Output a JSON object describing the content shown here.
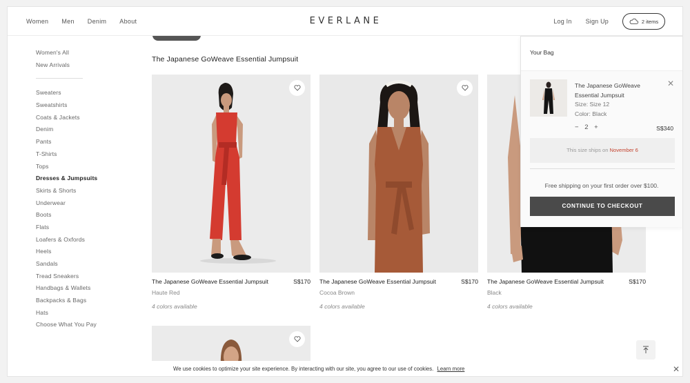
{
  "header": {
    "nav": [
      "Women",
      "Men",
      "Denim",
      "About"
    ],
    "logo": "EVERLANE",
    "login": "Log In",
    "signup": "Sign Up",
    "cart_count": "2 items"
  },
  "sidebar": {
    "top_items": [
      "Women's All",
      "New Arrivals"
    ],
    "items": [
      "Sweaters",
      "Sweatshirts",
      "Coats & Jackets",
      "Denim",
      "Pants",
      "T-Shirts",
      "Tops",
      "Dresses & Jumpsuits",
      "Skirts & Shorts",
      "Underwear",
      "Boots",
      "Flats",
      "Loafers & Oxfords",
      "Heels",
      "Sandals",
      "Tread Sneakers",
      "Handbags & Wallets",
      "Backpacks & Bags",
      "Hats",
      "Choose What You Pay"
    ],
    "active": "Dresses & Jumpsuits"
  },
  "main": {
    "title": "The Japanese GoWeave Essential Jumpsuit",
    "products": [
      {
        "name": "The Japanese GoWeave Essential Jumpsuit",
        "price": "S$170",
        "color": "Haute Red",
        "colors_available": "4 colors available",
        "swatch": "#d23a30"
      },
      {
        "name": "The Japanese GoWeave Essential Jumpsuit",
        "price": "S$170",
        "color": "Cocoa Brown",
        "colors_available": "4 colors available",
        "swatch": "#a65a38"
      },
      {
        "name": "The Japanese GoWeave Essential Jumpsuit",
        "price": "S$170",
        "color": "Black",
        "colors_available": "4 colors available",
        "swatch": "#111111"
      }
    ]
  },
  "bag": {
    "title": "Your Bag",
    "item_name": "The Japanese GoWeave Essential Jumpsuit",
    "size": "Size: Size 12",
    "color": "Color: Black",
    "qty_minus": "−",
    "qty": "2",
    "qty_plus": "+",
    "price": "S$340",
    "ship_note_prefix": "This size ships on",
    "ship_note_date": "November 6",
    "free_shipping": "Free shipping on your first order over $100.",
    "checkout": "CONTINUE TO CHECKOUT"
  },
  "cookie": {
    "message": "We use cookies to optimize your site experience. By interacting with our site, you agree to our use of cookies.",
    "learn_more": "Learn more"
  },
  "colors": {
    "accent_red": "#c44430",
    "checkout_bg": "#4a4a4a"
  }
}
